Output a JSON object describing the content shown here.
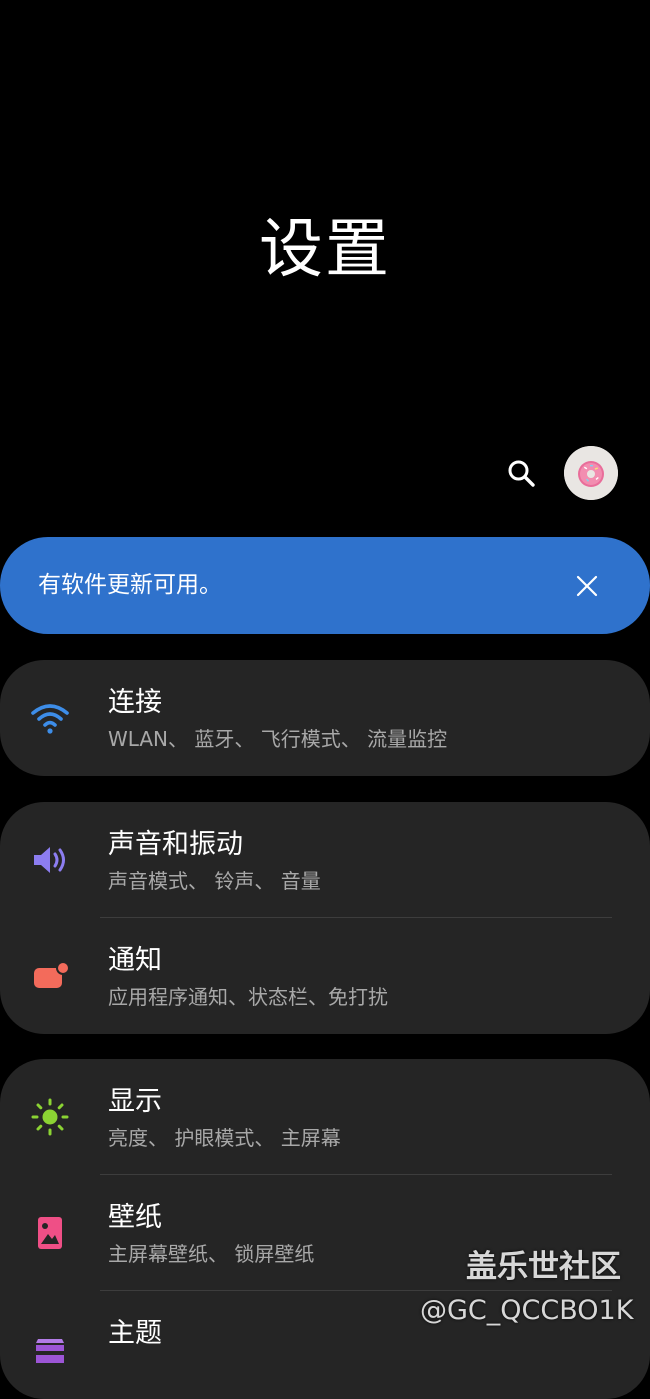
{
  "header": {
    "title": "设置"
  },
  "toolbar": {
    "search_icon": "search-icon",
    "avatar_icon": "donut-avatar"
  },
  "banner": {
    "text": "有软件更新可用。",
    "close_icon": "close-icon",
    "color": "#2f72cc"
  },
  "settings": {
    "connections": {
      "title": "连接",
      "subtitle": "WLAN、 蓝牙、 飞行模式、 流量监控",
      "icon": "wifi-icon",
      "icon_color": "#3d8de8"
    },
    "sound": {
      "title": "声音和振动",
      "subtitle": "声音模式、 铃声、 音量",
      "icon": "speaker-icon",
      "icon_color": "#8c7df0"
    },
    "notifications": {
      "title": "通知",
      "subtitle": "应用程序通知、状态栏、免打扰",
      "icon": "notification-icon",
      "icon_color": "#f36b5b"
    },
    "display": {
      "title": "显示",
      "subtitle": "亮度、 护眼模式、 主屏幕",
      "icon": "brightness-icon",
      "icon_color": "#8bd333"
    },
    "wallpaper": {
      "title": "壁纸",
      "subtitle": "主屏幕壁纸、 锁屏壁纸",
      "icon": "wallpaper-icon",
      "icon_color": "#ef4f86"
    },
    "themes": {
      "title": "主题",
      "icon": "theme-icon",
      "icon_color": "#9c55d6"
    }
  },
  "watermark": {
    "line1": "盖乐世社区",
    "line2": "@GC_QCCBO1K"
  }
}
